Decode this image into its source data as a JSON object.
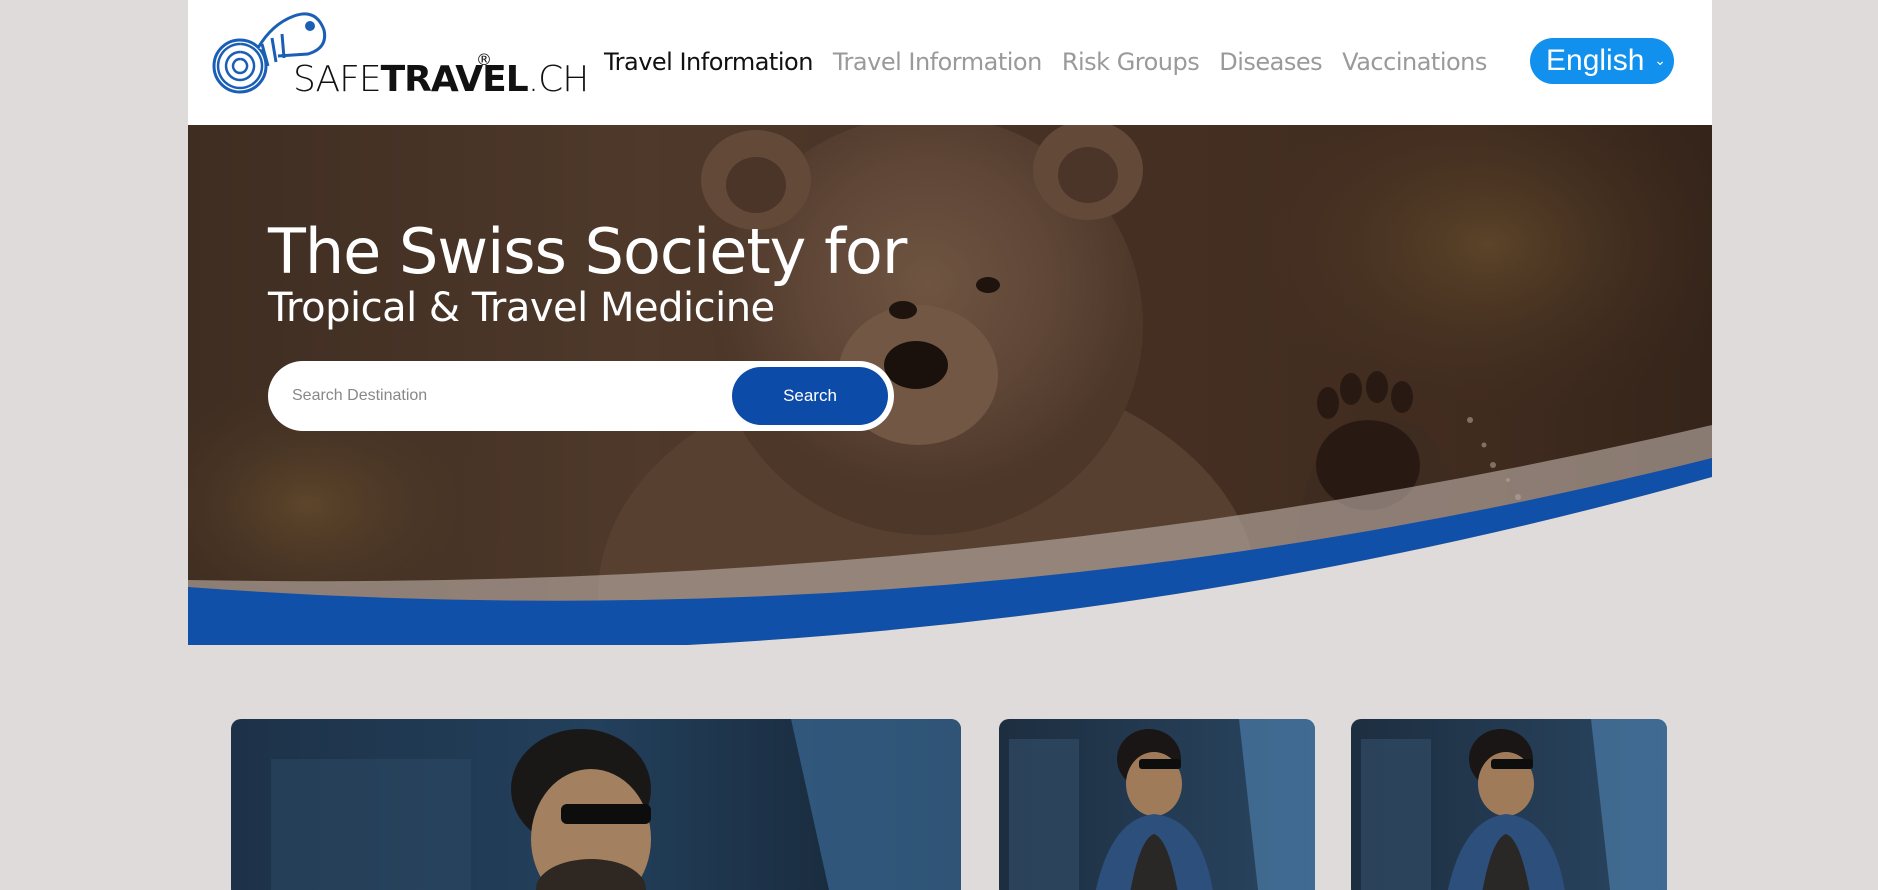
{
  "header": {
    "logo": {
      "light_text": "SAFE",
      "bold_text": "TRAVEL",
      "suffix_text": ".CH",
      "registered": "®"
    },
    "nav": [
      {
        "label": "Travel Information",
        "active": true
      },
      {
        "label": "Travel Information",
        "active": false
      },
      {
        "label": "Risk Groups",
        "active": false
      },
      {
        "label": "Diseases",
        "active": false
      },
      {
        "label": "Vaccinations",
        "active": false
      }
    ],
    "language": {
      "selected": "English",
      "icon": "chevron-down-icon"
    }
  },
  "hero": {
    "title": "The Swiss Society for",
    "subtitle": "Tropical & Travel Medicine",
    "search": {
      "placeholder": "Search Destination",
      "value": "",
      "button_label": "Search"
    }
  },
  "colors": {
    "page_bg": "#dedbda",
    "accent_blue": "#1190ee",
    "brand_blue": "#0d4ba8",
    "wave_blue": "#1150a8"
  }
}
